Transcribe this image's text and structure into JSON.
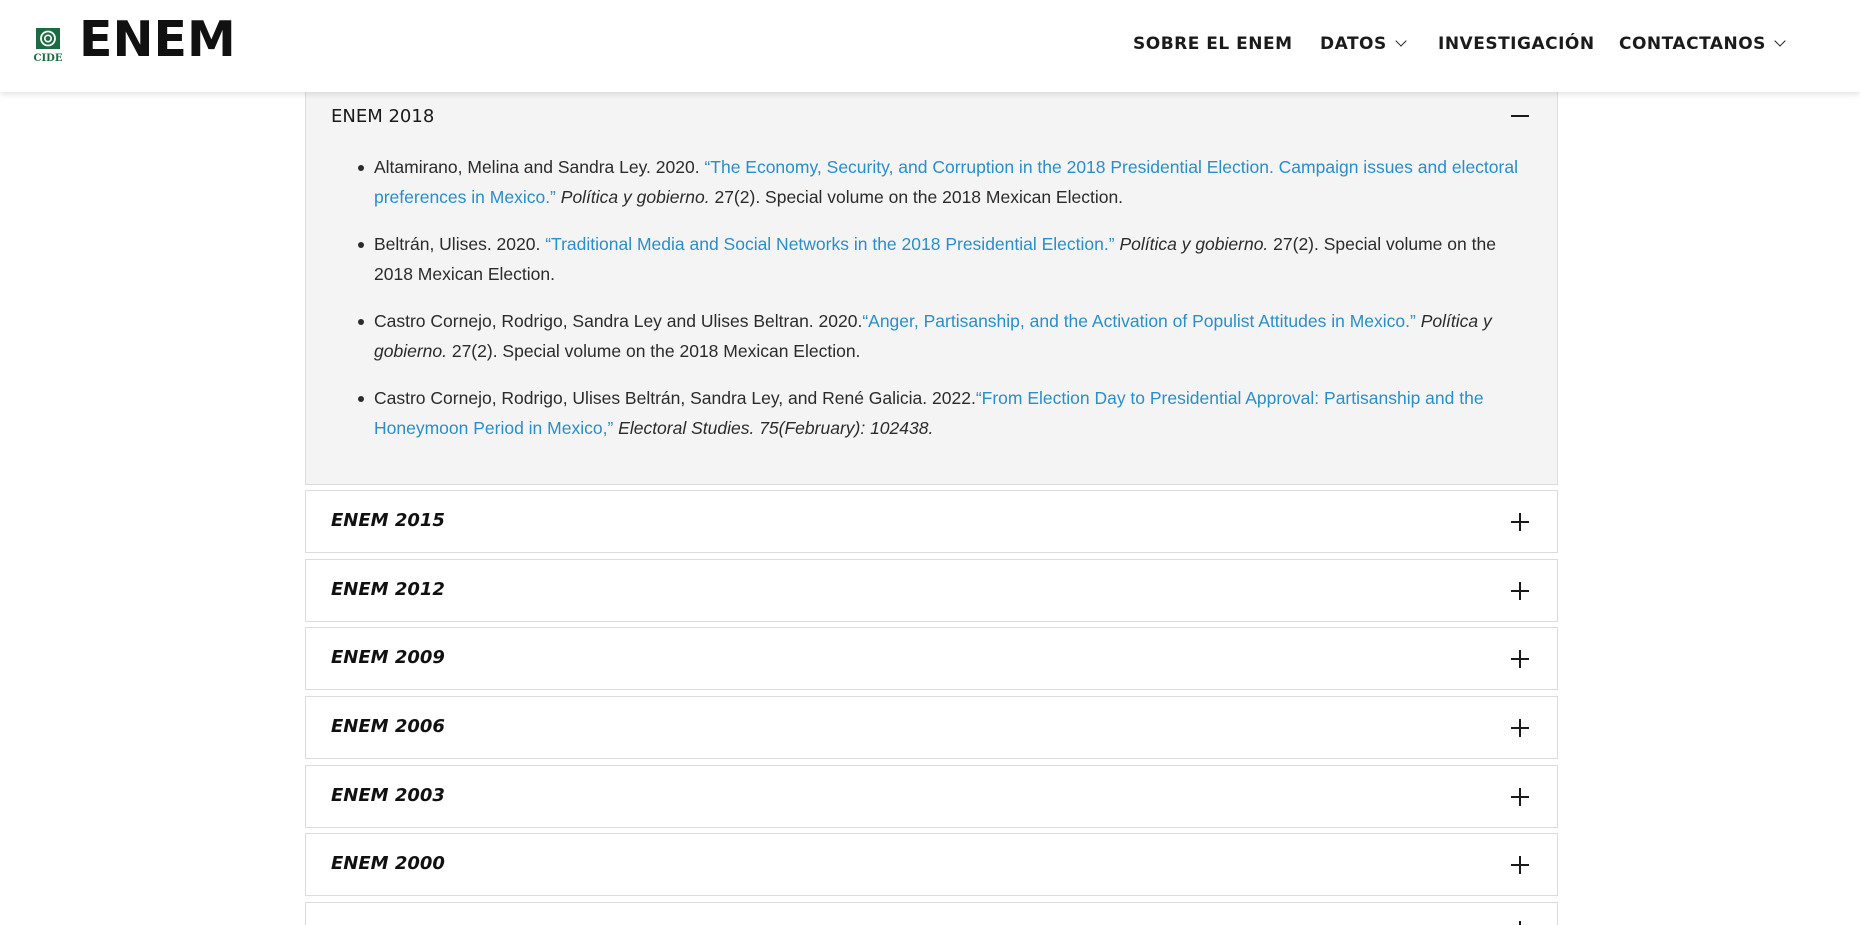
{
  "header": {
    "logo_text": "CIDE",
    "brand": "ENEM",
    "nav": [
      {
        "label": "SOBRE EL ENEM",
        "dropdown": false
      },
      {
        "label": "DATOS",
        "dropdown": true
      },
      {
        "label": "INVESTIGACIÓN",
        "dropdown": false
      },
      {
        "label": "CONTACTANOS",
        "dropdown": true
      }
    ]
  },
  "accordion": {
    "open": {
      "title": "ENEM 2018",
      "refs": [
        {
          "authors": "Altamirano, Melina and Sandra Ley. 2020. ",
          "link": "“The Economy, Security, and Corruption in the 2018 Presidential Election. Campaign issues and electoral preferences in Mexico.”",
          "journal": "Política y gobierno.",
          "rest": " 27(2). Special volume on the 2018 Mexican Election."
        },
        {
          "authors": "Beltrán, Ulises. 2020. ",
          "link": "“Traditional Media and Social Networks in the 2018 Presidential Election.”",
          "journal": "Política y gobierno.",
          "rest": " 27(2). Special volume on the 2018 Mexican Election."
        },
        {
          "authors": "Castro Cornejo, Rodrigo, Sandra Ley and Ulises Beltran. 2020.",
          "link": "“Anger, Partisanship, and the Activation of Populist Attitudes in Mexico.”",
          "journal": "Política y gobierno.",
          "rest": " 27(2). Special volume on the 2018 Mexican Election."
        },
        {
          "authors": "Castro Cornejo, Rodrigo, Ulises Beltrán, Sandra Ley, and René Galicia. 2022.",
          "link": "“From Election Day to Presidential Approval: Partisanship and the Honeymoon Period in Mexico,”",
          "journal": "Electoral Studies. 75(February): 102438.",
          "rest": ""
        }
      ]
    },
    "closed": [
      "ENEM 2015",
      "ENEM 2012",
      "ENEM 2009",
      "ENEM 2006",
      "ENEM 2003",
      "ENEM 2000",
      ""
    ]
  },
  "colors": {
    "link": "#2a8fc6",
    "logo_green": "#1e6b43"
  }
}
